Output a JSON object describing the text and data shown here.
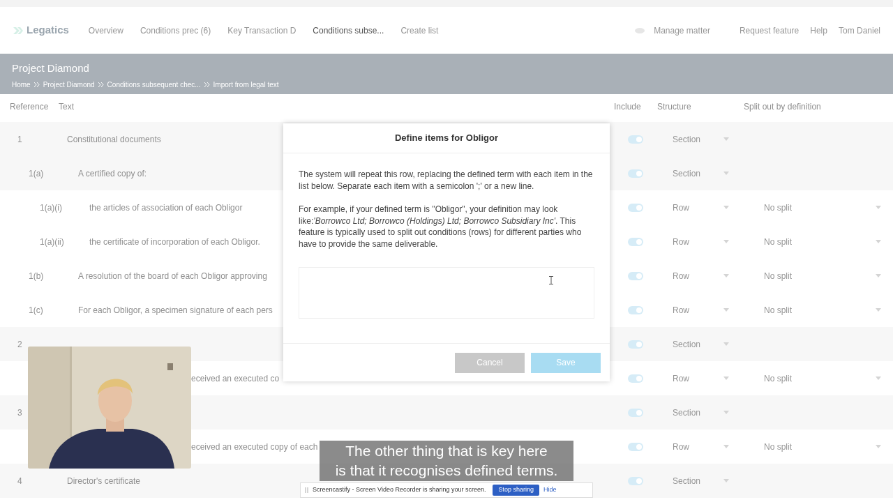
{
  "nav": {
    "logo": "Legatics",
    "tabs": [
      {
        "label": "Overview",
        "selected": false
      },
      {
        "label": "Conditions prec (6)",
        "selected": false
      },
      {
        "label": "Key Transaction D",
        "selected": false
      },
      {
        "label": "Conditions subse...",
        "selected": true
      }
    ],
    "create": "Create list",
    "right": [
      "Manage matter",
      "Request feature",
      "Help",
      "Tom Daniel"
    ]
  },
  "header": {
    "title": "Project Diamond",
    "breadcrumbs": [
      "Home",
      "Project Diamond",
      "Conditions subsequent chec...",
      "Import from legal text"
    ]
  },
  "table": {
    "columns": [
      "Reference",
      "Text",
      "Include",
      "Structure",
      "Split out by definition"
    ],
    "rows": [
      {
        "ref": "1",
        "text": "Constitutional documents",
        "include": true,
        "structure": "Section",
        "children": [
          {
            "ref": "1(a)",
            "text": "A certified copy of:",
            "include": true,
            "structure": "Section",
            "children": [
              {
                "ref": "1(a)(i)",
                "text": "the articles of association of each Obligor",
                "include": true,
                "structure": "Row",
                "split": "No split"
              },
              {
                "ref": "1(a)(ii)",
                "text": "the certificate of incorporation of each Obligor.",
                "include": true,
                "structure": "Row",
                "split": "No split"
              }
            ]
          },
          {
            "ref": "1(b)",
            "text": "A resolution of the board of each Obligor approving",
            "include": true,
            "structure": "Row",
            "split": "No split"
          },
          {
            "ref": "1(c)",
            "text": "For each Obligor, a specimen signature of each pers",
            "include": true,
            "structure": "Row",
            "split": "No split"
          }
        ]
      },
      {
        "ref": "2",
        "include": true,
        "structure": "Section",
        "children": [
          {
            "text": "eceived an executed co",
            "partial": true,
            "include": true,
            "structure": "Row",
            "split": "No split"
          }
        ]
      },
      {
        "ref": "3",
        "include": true,
        "structure": "Section",
        "children": [
          {
            "text": "eceived an executed copy of each",
            "partial": true,
            "include": true,
            "structure": "Row",
            "split": "No split"
          }
        ]
      },
      {
        "ref": "4",
        "text": "Director's certificate",
        "include": true,
        "structure": "Section"
      }
    ]
  },
  "modal": {
    "title": "Define items for Obligor",
    "paragraphs": [
      "The system will repeat this row, replacing the defined term with each item in the list below. Separate each item with a semicolon ';' or a new line.",
      "For example, if your defined term is \"Obligor\", your definition may look like:*'Borrowco Ltd; Borrowco (Holdings) Ltd; Borrowco Subsidiary Inc'*. This feature is typically used to split out conditions (rows) for different parties who have to provide the same deliverable."
    ],
    "buttons": [
      {
        "label": "Cancel",
        "kind": "secondary",
        "disabled": false
      },
      {
        "label": "Save",
        "kind": "primary",
        "disabled": true
      }
    ]
  },
  "caption": [
    "The other thing that is key here",
    "is that it recognises defined terms."
  ],
  "share_bar": {
    "message": "Screencastify - Screen Video Recorder is sharing your screen.",
    "stop": "Stop sharing",
    "hide": "Hide"
  }
}
